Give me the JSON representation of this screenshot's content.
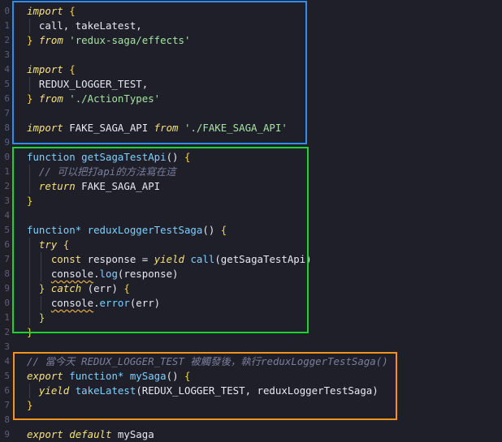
{
  "editor": {
    "line_numbers": [
      "0",
      "1",
      "2",
      "3",
      "4",
      "5",
      "6",
      "7",
      "8",
      "9",
      "0",
      "1",
      "2",
      "3",
      "4",
      "5",
      "6",
      "7",
      "8",
      "9",
      "0",
      "1",
      "2",
      "3",
      "4",
      "5",
      "6",
      "7",
      "8",
      "9"
    ],
    "lines": [
      {
        "tokens": [
          {
            "t": "import",
            "c": "kw"
          },
          {
            "t": " ",
            "c": ""
          },
          {
            "t": "{",
            "c": "br"
          }
        ]
      },
      {
        "tokens": [
          {
            "t": "  call, takeLatest,",
            "c": ""
          }
        ]
      },
      {
        "tokens": [
          {
            "t": "}",
            "c": "br"
          },
          {
            "t": " ",
            "c": ""
          },
          {
            "t": "from",
            "c": "kw"
          },
          {
            "t": " ",
            "c": ""
          },
          {
            "t": "'redux-saga/effects'",
            "c": "str"
          }
        ]
      },
      {
        "tokens": []
      },
      {
        "tokens": [
          {
            "t": "import",
            "c": "kw"
          },
          {
            "t": " ",
            "c": ""
          },
          {
            "t": "{",
            "c": "br"
          }
        ]
      },
      {
        "tokens": [
          {
            "t": "  REDUX_LOGGER_TEST,",
            "c": ""
          }
        ]
      },
      {
        "tokens": [
          {
            "t": "}",
            "c": "br"
          },
          {
            "t": " ",
            "c": ""
          },
          {
            "t": "from",
            "c": "kw"
          },
          {
            "t": " ",
            "c": ""
          },
          {
            "t": "'./ActionTypes'",
            "c": "str"
          }
        ]
      },
      {
        "tokens": []
      },
      {
        "tokens": [
          {
            "t": "import",
            "c": "kw"
          },
          {
            "t": " FAKE_SAGA_API ",
            "c": ""
          },
          {
            "t": "from",
            "c": "kw"
          },
          {
            "t": " ",
            "c": ""
          },
          {
            "t": "'./FAKE_SAGA_API'",
            "c": "str"
          }
        ]
      },
      {
        "tokens": []
      },
      {
        "tokens": [
          {
            "t": "function",
            "c": "fn"
          },
          {
            "t": " ",
            "c": ""
          },
          {
            "t": "getSagaTestApi",
            "c": "fn"
          },
          {
            "t": "() ",
            "c": ""
          },
          {
            "t": "{",
            "c": "br"
          }
        ]
      },
      {
        "tokens": [
          {
            "t": "  // 可以把打api的方法寫在這",
            "c": "cm"
          }
        ]
      },
      {
        "tokens": [
          {
            "t": "  ",
            "c": ""
          },
          {
            "t": "return",
            "c": "kw"
          },
          {
            "t": " FAKE_SAGA_API",
            "c": ""
          }
        ]
      },
      {
        "tokens": [
          {
            "t": "}",
            "c": "br"
          }
        ]
      },
      {
        "tokens": []
      },
      {
        "tokens": [
          {
            "t": "function*",
            "c": "fn"
          },
          {
            "t": " ",
            "c": ""
          },
          {
            "t": "reduxLoggerTestSaga",
            "c": "fn"
          },
          {
            "t": "() ",
            "c": ""
          },
          {
            "t": "{",
            "c": "br"
          }
        ]
      },
      {
        "tokens": [
          {
            "t": "  ",
            "c": ""
          },
          {
            "t": "try",
            "c": "kw"
          },
          {
            "t": " ",
            "c": ""
          },
          {
            "t": "{",
            "c": "br"
          }
        ]
      },
      {
        "tokens": [
          {
            "t": "    ",
            "c": ""
          },
          {
            "t": "const",
            "c": "kwn"
          },
          {
            "t": " response = ",
            "c": ""
          },
          {
            "t": "yield",
            "c": "kw"
          },
          {
            "t": " ",
            "c": ""
          },
          {
            "t": "call",
            "c": "fn"
          },
          {
            "t": "(getSagaTestApi)",
            "c": ""
          }
        ]
      },
      {
        "tokens": [
          {
            "t": "    ",
            "c": ""
          },
          {
            "t": "console",
            "c": "sq"
          },
          {
            "t": ".",
            "c": ""
          },
          {
            "t": "log",
            "c": "fn"
          },
          {
            "t": "(response)",
            "c": ""
          }
        ]
      },
      {
        "tokens": [
          {
            "t": "  ",
            "c": ""
          },
          {
            "t": "}",
            "c": "br"
          },
          {
            "t": " ",
            "c": ""
          },
          {
            "t": "catch",
            "c": "kw"
          },
          {
            "t": " (err) ",
            "c": ""
          },
          {
            "t": "{",
            "c": "br"
          }
        ]
      },
      {
        "tokens": [
          {
            "t": "    ",
            "c": ""
          },
          {
            "t": "console",
            "c": "sq"
          },
          {
            "t": ".",
            "c": ""
          },
          {
            "t": "error",
            "c": "fn"
          },
          {
            "t": "(err)",
            "c": ""
          }
        ]
      },
      {
        "tokens": [
          {
            "t": "  ",
            "c": ""
          },
          {
            "t": "}",
            "c": "br"
          }
        ]
      },
      {
        "tokens": [
          {
            "t": "}",
            "c": "br"
          }
        ]
      },
      {
        "tokens": []
      },
      {
        "tokens": [
          {
            "t": "// 當今天 REDUX_LOGGER_TEST 被觸發後，執行reduxLoggerTestSaga()",
            "c": "cm"
          }
        ]
      },
      {
        "tokens": [
          {
            "t": "export",
            "c": "kw"
          },
          {
            "t": " ",
            "c": ""
          },
          {
            "t": "function*",
            "c": "fn"
          },
          {
            "t": " ",
            "c": ""
          },
          {
            "t": "mySaga",
            "c": "fn"
          },
          {
            "t": "() ",
            "c": ""
          },
          {
            "t": "{",
            "c": "br"
          }
        ]
      },
      {
        "tokens": [
          {
            "t": "  ",
            "c": ""
          },
          {
            "t": "yield",
            "c": "kw"
          },
          {
            "t": " ",
            "c": ""
          },
          {
            "t": "takeLatest",
            "c": "fn"
          },
          {
            "t": "(REDUX_LOGGER_TEST, reduxLoggerTestSaga)",
            "c": ""
          }
        ]
      },
      {
        "tokens": [
          {
            "t": "}",
            "c": "br"
          }
        ]
      },
      {
        "tokens": []
      },
      {
        "tokens": [
          {
            "t": "export",
            "c": "kw"
          },
          {
            "t": " ",
            "c": ""
          },
          {
            "t": "default",
            "c": "kw"
          },
          {
            "t": " mySaga",
            "c": ""
          }
        ]
      }
    ]
  },
  "highlights": {
    "imports_color": "#2f8df0",
    "saga_functions_color": "#1fd32e",
    "root_saga_color": "#f3921e"
  },
  "theme": {
    "background": "#1e1f28",
    "keyword": "#f7e27a",
    "function": "#7fd0ff",
    "string": "#a6e3a1",
    "comment": "#7a7f9e"
  }
}
